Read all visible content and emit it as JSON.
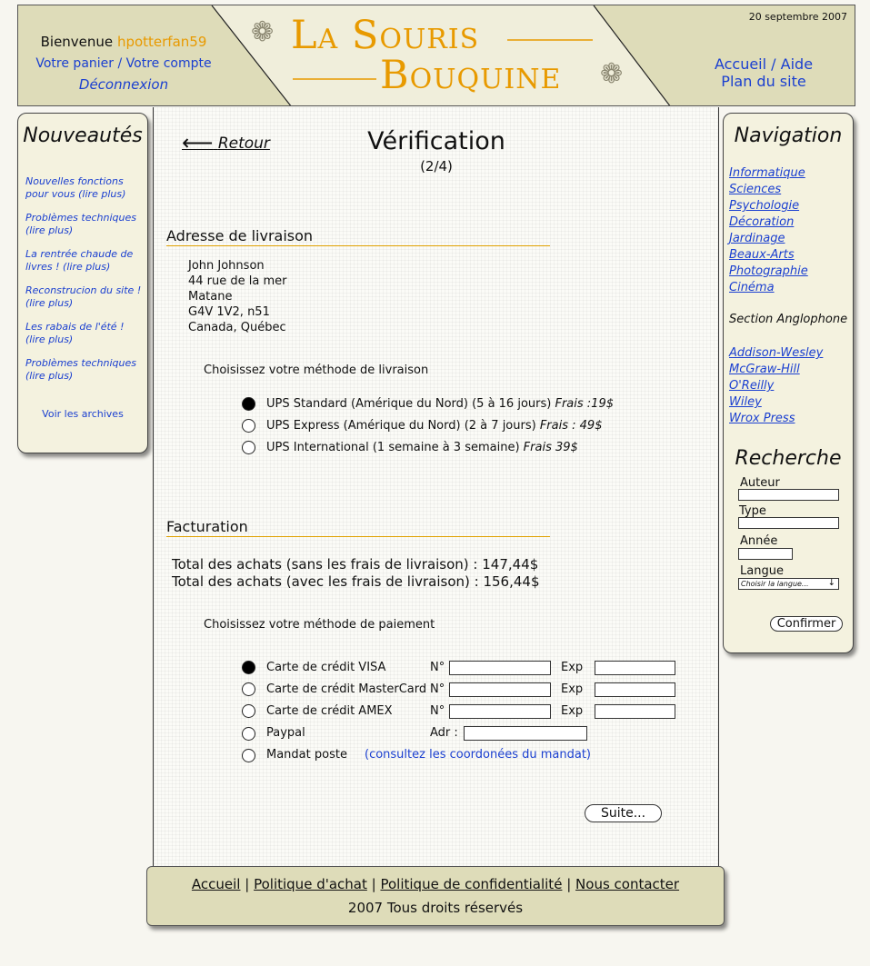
{
  "header": {
    "welcome_prefix": "Bienvenue",
    "username": "hpotterfan59",
    "cart_link": "Votre panier",
    "separator": "/",
    "account_link": "Votre compte",
    "logout_link": "Déconnexion",
    "logo_line1": "La Souris",
    "logo_line2": "Bouquine",
    "date": "20 septembre 2007",
    "nav_home": "Accueil",
    "nav_help": "Aide",
    "nav_sitemap": "Plan du site",
    "colors": {
      "beige": "#dedcb9",
      "logo_orange": "#e89a00",
      "username_orange": "#e89a00",
      "link_blue": "#1a3fd0"
    }
  },
  "left_panel": {
    "title": "Nouveautés",
    "items": [
      {
        "line1": "Nouvelles fonctions",
        "line2": "pour vous (lire plus)"
      },
      {
        "line1": "Problèmes techniques",
        "line2": "(lire plus)"
      },
      {
        "line1": "La rentrée chaude de",
        "line2": "livres ! (lire plus)"
      },
      {
        "line1": "Reconstrucion du site !",
        "line2": "(lire plus)"
      },
      {
        "line1": "Les rabais de l'été !",
        "line2": "(lire plus)"
      },
      {
        "line1": "Problèmes techniques",
        "line2": "(lire plus)"
      }
    ],
    "archives": "Voir les archives"
  },
  "right_panel": {
    "title": "Navigation",
    "categories": [
      "Informatique",
      "Sciences",
      "Psychologie",
      "Décoration",
      "Jardinage",
      "Beaux-Arts",
      "Photographie",
      "Cinéma"
    ],
    "english_section": "Section Anglophone",
    "publishers": [
      "Addison-Wesley",
      "McGraw-Hill",
      "O'Reilly",
      "Wiley",
      "Wrox Press"
    ],
    "search": {
      "title": "Recherche",
      "author_label": "Auteur",
      "type_label": "Type",
      "year_label": "Année",
      "language_label": "Langue",
      "language_select": "Choisir la langue...",
      "submit": "Confirmer"
    }
  },
  "main": {
    "back": "Retour",
    "title": "Vérification",
    "step": "(2/4)",
    "shipping_heading": "Adresse de livraison",
    "address": [
      "John Johnson",
      "44 rue de la mer",
      "Matane",
      "G4V 1V2, n51",
      "Canada, Québec"
    ],
    "shipping_prompt": "Choisissez votre méthode de livraison",
    "shipping_options": [
      {
        "label": "UPS Standard (Amérique du Nord) (5 à 16 jours)",
        "fee": "Frais :19$",
        "selected": true
      },
      {
        "label": "UPS Express (Amérique du Nord) (2 à 7 jours)",
        "fee": "Frais : 49$",
        "selected": false
      },
      {
        "label": "UPS International (1 semaine à 3 semaine)",
        "fee": "Frais 39$",
        "selected": false
      }
    ],
    "billing_heading": "Facturation",
    "total_without": "Total des achats (sans les frais de livraison) : 147,44$",
    "total_with": "Total des achats (avec les frais de livraison) : 156,44$",
    "payment_prompt": "Choisissez votre méthode de paiement",
    "payment_options": [
      {
        "label": "Carte de crédit VISA",
        "selected": true,
        "num_label": "N°",
        "exp_label": "Exp"
      },
      {
        "label": "Carte de crédit MasterCard",
        "selected": false,
        "num_label": "N°",
        "exp_label": "Exp"
      },
      {
        "label": "Carte de crédit AMEX",
        "selected": false,
        "num_label": "N°",
        "exp_label": "Exp"
      }
    ],
    "paypal_label": "Paypal",
    "paypal_addr_label": "Adr :",
    "mandat_label": "Mandat poste",
    "mandat_link": "(consultez les coordonées du mandat)",
    "next_button": "Suite..."
  },
  "footer": {
    "links": [
      "Accueil",
      "Politique d'achat",
      "Politique de confidentialité",
      "Nous contacter"
    ],
    "sep": "|",
    "copyright": "2007 Tous droits réservés"
  }
}
